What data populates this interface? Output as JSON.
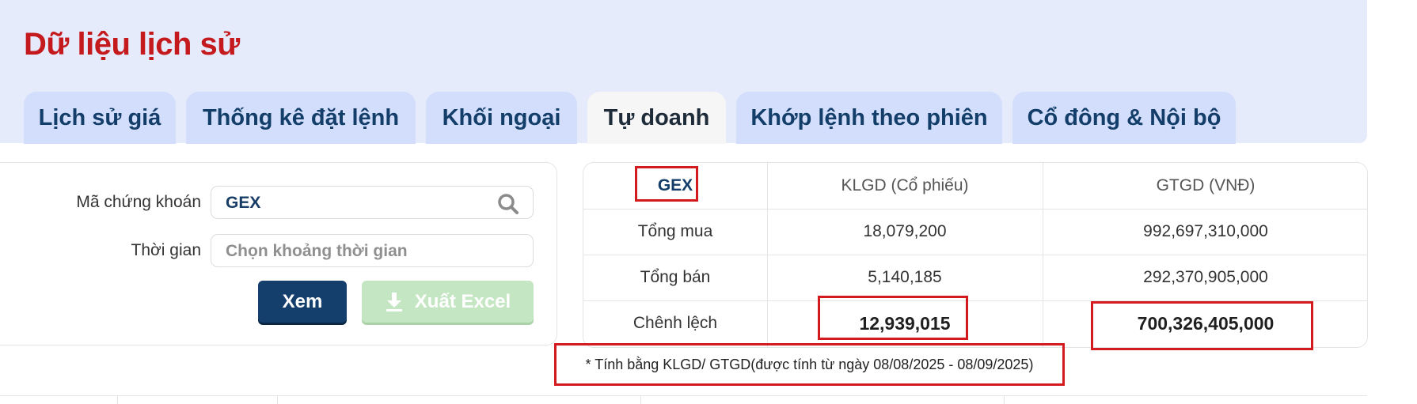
{
  "page": {
    "title": "Dữ liệu lịch sử"
  },
  "tabs": [
    {
      "label": "Lịch sử giá",
      "active": false
    },
    {
      "label": "Thống kê đặt lệnh",
      "active": false
    },
    {
      "label": "Khối ngoại",
      "active": false
    },
    {
      "label": "Tự doanh",
      "active": true
    },
    {
      "label": "Khớp lệnh theo phiên",
      "active": false
    },
    {
      "label": "Cổ đông & Nội bộ",
      "active": false
    }
  ],
  "filter": {
    "symbol_label": "Mã chứng khoán",
    "symbol_value": "GEX",
    "time_label": "Thời gian",
    "time_placeholder": "Chọn khoảng thời gian",
    "view_button": "Xem",
    "export_button": "Xuất Excel"
  },
  "summary": {
    "ticker": "GEX",
    "col_volume": "KLGD (Cổ phiếu)",
    "col_value": "GTGD (VNĐ)",
    "rows": [
      {
        "label": "Tổng mua",
        "volume": "18,079,200",
        "value": "992,697,310,000"
      },
      {
        "label": "Tổng bán",
        "volume": "5,140,185",
        "value": "292,370,905,000"
      },
      {
        "label": "Chênh lệch",
        "volume": "12,939,015",
        "value": "700,326,405,000"
      }
    ]
  },
  "note": "* Tính bằng KLGD/ GTGD(được tính từ ngày 08/08/2025 - 08/09/2025)",
  "colors": {
    "title": "#c51a1d",
    "tab_bg": "#d2defb",
    "tab_text": "#143e6a",
    "header_bg": "#e6ebfb",
    "primary_button": "#143f6c",
    "export_button_disabled": "#c5e6c3",
    "highlight": "#d31a1f"
  },
  "icons": {
    "search": "search-icon",
    "download": "download-icon"
  }
}
